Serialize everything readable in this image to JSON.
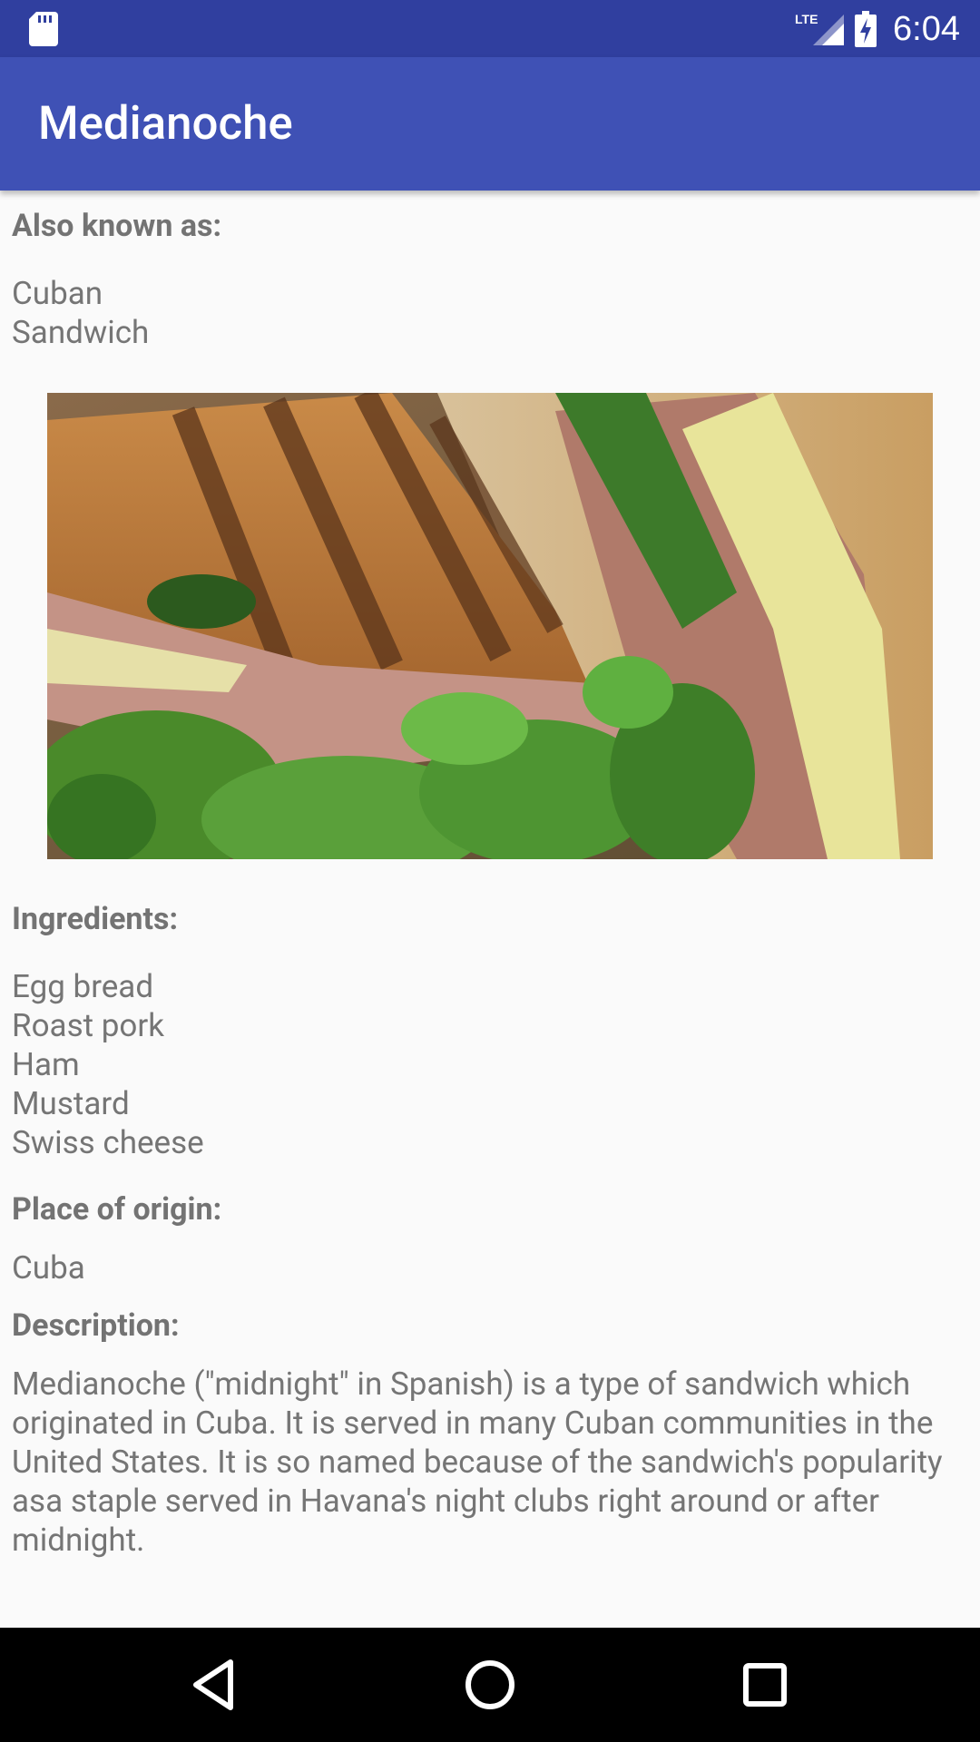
{
  "status_bar": {
    "time": "6:04",
    "network_label": "LTE",
    "icons": [
      "sd-card-icon",
      "lte-signal-icon",
      "battery-charging-icon"
    ]
  },
  "app_bar": {
    "title": "Medianoche",
    "background": "#3f51b5",
    "status_background": "#303f9f"
  },
  "details": {
    "aka_label": "Also known as:",
    "aka_values": [
      "Cuban",
      "Sandwich"
    ],
    "image_icon": "sandwich-photo",
    "ingredients_label": "Ingredients:",
    "ingredients": [
      "Egg bread",
      "Roast pork",
      "Ham",
      "Mustard",
      "Swiss cheese"
    ],
    "origin_label": "Place of origin:",
    "origin": "Cuba",
    "description_label": "Description:",
    "description": "Medianoche (\"midnight\" in Spanish) is a type of sandwich which originated in Cuba. It is served in many Cuban communities in the United States. It is so named because of the sandwich's popularity asa staple served in Havana's night clubs right around or after midnight."
  },
  "nav_bar": {
    "icons": [
      "back-icon",
      "home-icon",
      "recent-apps-icon"
    ]
  }
}
